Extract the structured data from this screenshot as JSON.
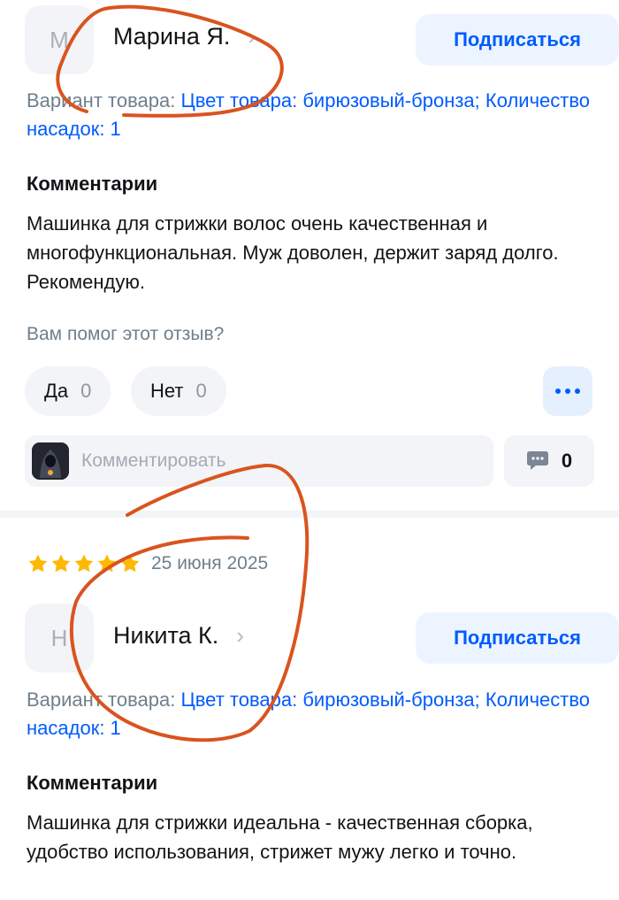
{
  "reviews": [
    {
      "author": {
        "initial": "М",
        "name": "Марина Я."
      },
      "subscribe_label": "Подписаться",
      "variant": {
        "label": "Вариант товара:",
        "value": "Цвет товара: бирюзовый-бронза; Количество насадок: 1"
      },
      "comments_title": "Комментарии",
      "comment_text": "Машинка для стрижки волос очень качественная и многофункциональная. Муж доволен, держит заряд долго. Рекомендую.",
      "helpful_question": "Вам помог этот отзыв?",
      "yes": {
        "label": "Да",
        "count": "0"
      },
      "no": {
        "label": "Нет",
        "count": "0"
      },
      "comment_placeholder": "Комментировать",
      "comments_count": "0"
    },
    {
      "rating": 5,
      "date": "25 июня 2025",
      "author": {
        "initial": "Н",
        "name": "Никита К."
      },
      "subscribe_label": "Подписаться",
      "variant": {
        "label": "Вариант товара:",
        "value": "Цвет товара: бирюзовый-бронза; Количество насадок: 1"
      },
      "comments_title": "Комментарии",
      "comment_text": "Машинка для стрижки идеальна - качественная сборка, удобство использования, стрижет мужу легко и точно."
    }
  ],
  "colors": {
    "accent": "#005bff",
    "star": "#ffb800",
    "annotation": "#d9541e",
    "muted": "#707f8d"
  },
  "icons": [
    "chevron-right-icon",
    "more-dots-icon",
    "comment-bubble-icon",
    "star-icon"
  ]
}
